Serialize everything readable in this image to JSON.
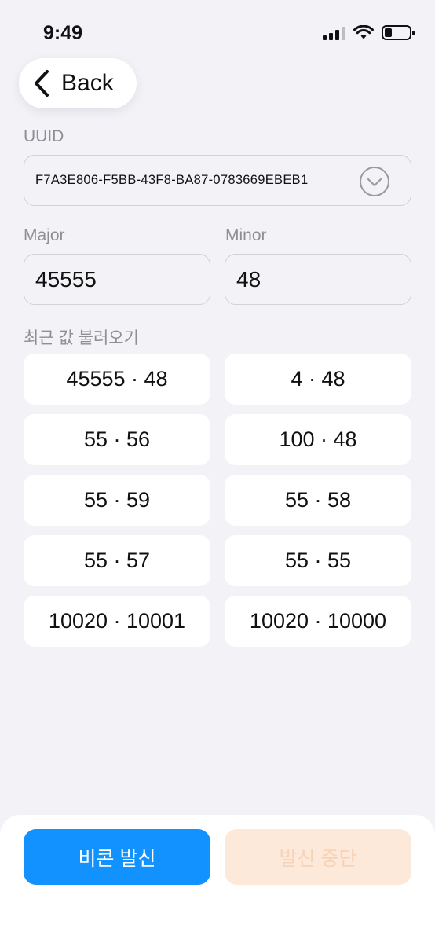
{
  "status_bar": {
    "time": "9:49"
  },
  "nav": {
    "back_label": "Back"
  },
  "uuid": {
    "label": "UUID",
    "value": "F7A3E806-F5BB-43F8-BA87-0783669EBEB1"
  },
  "major": {
    "label": "Major",
    "value": "45555"
  },
  "minor": {
    "label": "Minor",
    "value": "48"
  },
  "recent": {
    "label": "최근 값 불러오기",
    "items": [
      "45555 · 48",
      "4 · 48",
      "55 · 56",
      "100 · 48",
      "55 · 59",
      "55 · 58",
      "55 · 57",
      "55 · 55",
      "10020 · 10001",
      "10020 · 10000"
    ]
  },
  "actions": {
    "start_label": "비콘 발신",
    "stop_label": "발신 중단"
  },
  "colors": {
    "accent": "#1192ff",
    "stop_disabled_bg": "#fde9da",
    "background": "#f2f2f7"
  }
}
